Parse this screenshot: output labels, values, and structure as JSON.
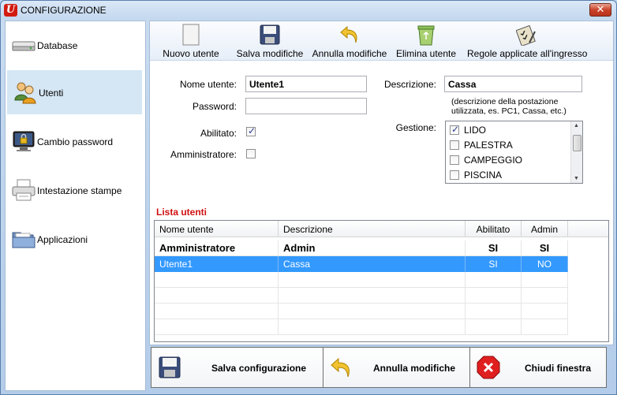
{
  "window": {
    "title": "CONFIGURAZIONE",
    "close_label": "✕"
  },
  "sidebar": {
    "items": [
      {
        "label": "Database",
        "icon": "database-drive-icon"
      },
      {
        "label": "Utenti",
        "icon": "users-icon",
        "selected": true
      },
      {
        "label": "Cambio password",
        "icon": "monitor-lock-icon"
      },
      {
        "label": "Intestazione stampe",
        "icon": "printer-icon"
      },
      {
        "label": "Applicazioni",
        "icon": "folder-icon"
      }
    ]
  },
  "toolbar": {
    "new_user": "Nuovo utente",
    "save_changes": "Salva modifiche",
    "undo_changes": "Annulla modifiche",
    "delete_user": "Elimina utente",
    "access_rules": "Regole applicate all'ingresso"
  },
  "form": {
    "username_label": "Nome utente:",
    "username_value": "Utente1",
    "password_label": "Password:",
    "password_value": "",
    "enabled_label": "Abilitato:",
    "enabled_checked": true,
    "admin_label": "Amministratore:",
    "admin_checked": false,
    "description_label": "Descrizione:",
    "description_value": "Cassa",
    "description_hint_1": "(descrizione della postazione",
    "description_hint_2": "utilizzata, es. PC1, Cassa, etc.)",
    "management_label": "Gestione:",
    "management_items": [
      {
        "label": "LIDO",
        "checked": true
      },
      {
        "label": "PALESTRA",
        "checked": false
      },
      {
        "label": "CAMPEGGIO",
        "checked": false
      },
      {
        "label": "PISCINA",
        "checked": false
      }
    ]
  },
  "users_list": {
    "title": "Lista utenti",
    "columns": [
      "Nome utente",
      "Descrizione",
      "Abilitato",
      "Admin"
    ],
    "rows": [
      {
        "name": "Amministratore",
        "description": "Admin",
        "enabled": "SI",
        "admin": "SI"
      },
      {
        "name": "Utente1",
        "description": "Cassa",
        "enabled": "SI",
        "admin": "NO"
      }
    ]
  },
  "bottom": {
    "save_config": "Salva configurazione",
    "undo_changes": "Annulla modifiche",
    "close_window": "Chiudi finestra"
  },
  "colors": {
    "selection": "#3399ff",
    "section_title": "#d01010",
    "nav_selected": "#d5e6f4"
  }
}
